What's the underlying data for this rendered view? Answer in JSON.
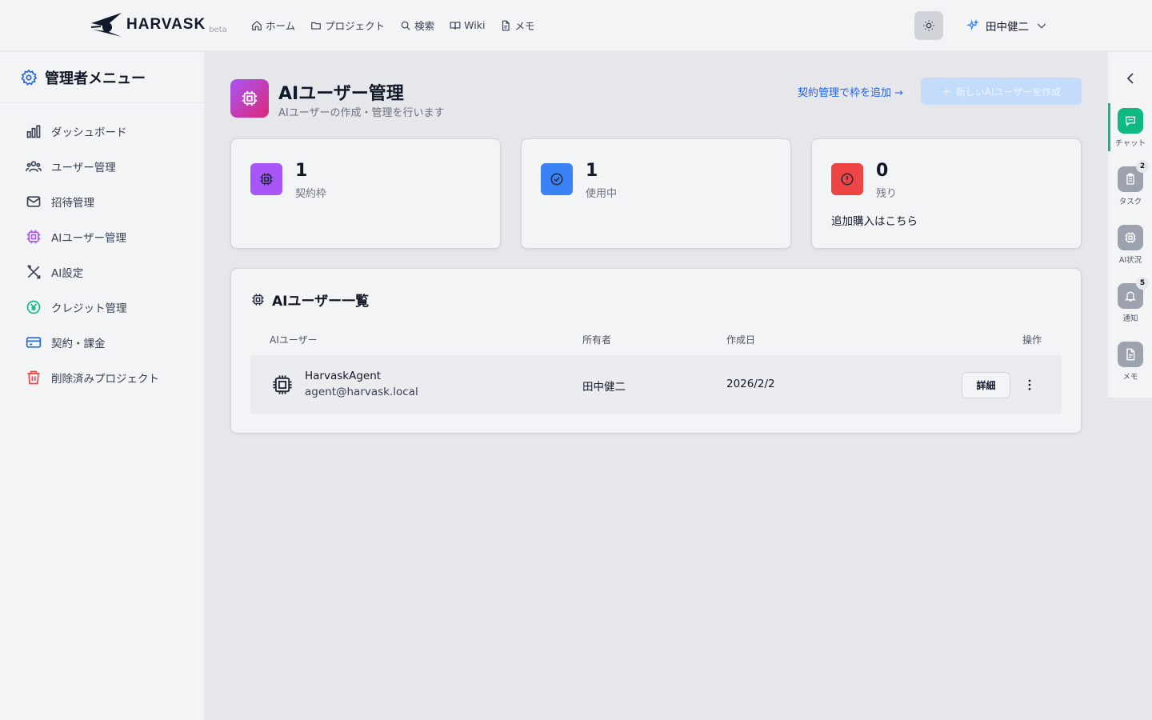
{
  "header": {
    "logo_text": "HARVASK",
    "logo_badge": "beta",
    "nav": [
      {
        "label": "ホーム",
        "icon": "home-icon"
      },
      {
        "label": "プロジェクト",
        "icon": "folder-icon"
      },
      {
        "label": "検索",
        "icon": "search-icon"
      },
      {
        "label": "Wiki",
        "icon": "book-icon"
      },
      {
        "label": "メモ",
        "icon": "note-icon"
      }
    ],
    "user_name": "田中健二"
  },
  "sidebar": {
    "title": "管理者メニュー",
    "items": [
      {
        "label": "ダッシュボード",
        "icon": "chart-icon",
        "color": "#374151"
      },
      {
        "label": "ユーザー管理",
        "icon": "users-icon",
        "color": "#374151"
      },
      {
        "label": "招待管理",
        "icon": "mail-icon",
        "color": "#374151"
      },
      {
        "label": "AIユーザー管理",
        "icon": "cpu-icon",
        "color": "#a855f7"
      },
      {
        "label": "AI設定",
        "icon": "tools-icon",
        "color": "#374151"
      },
      {
        "label": "クレジット管理",
        "icon": "yen-icon",
        "color": "#10b981"
      },
      {
        "label": "契約・課金",
        "icon": "card-icon",
        "color": "#2563eb"
      },
      {
        "label": "削除済みプロジェクト",
        "icon": "trash-icon",
        "color": "#ef4444"
      }
    ]
  },
  "page": {
    "title": "AIユーザー管理",
    "subtitle": "AIユーザーの作成・管理を行います",
    "contract_link": "契約管理で枠を追加 →",
    "create_button": "新しいAIユーザーを作成"
  },
  "stats": [
    {
      "value": "1",
      "label": "契約枠",
      "color": "#a855f7",
      "icon": "cpu-icon"
    },
    {
      "value": "1",
      "label": "使用中",
      "color": "#3b82f6",
      "icon": "check-circle-icon"
    },
    {
      "value": "0",
      "label": "残り",
      "color": "#ef4444",
      "icon": "alert-circle-icon",
      "link": "追加購入はこちら"
    }
  ],
  "ai_users": {
    "title": "AIユーザー一覧",
    "columns": [
      "AIユーザー",
      "所有者",
      "作成日",
      "操作"
    ],
    "rows": [
      {
        "name": "HarvaskAgent",
        "email": "agent@harvask.local",
        "owner": "田中健二",
        "created": "2026/2/2",
        "action": "詳細"
      }
    ]
  },
  "rail": {
    "items": [
      {
        "label": "チャット",
        "icon": "chat-icon",
        "color": "#10b981",
        "badge": ""
      },
      {
        "label": "タスク",
        "icon": "clipboard-icon",
        "color": "#9ca3af",
        "badge": "2"
      },
      {
        "label": "AI状況",
        "icon": "cpu-icon",
        "color": "#9ca3af",
        "badge": ""
      },
      {
        "label": "通知",
        "icon": "bell-icon",
        "color": "#9ca3af",
        "badge": "5"
      },
      {
        "label": "メモ",
        "icon": "note-icon",
        "color": "#9ca3af",
        "badge": ""
      }
    ]
  }
}
